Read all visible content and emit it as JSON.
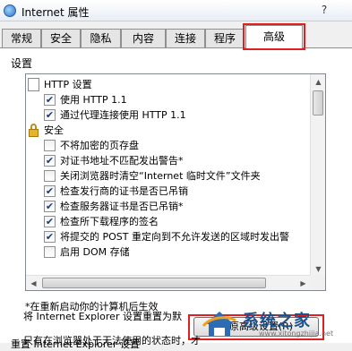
{
  "window": {
    "title": "Internet 属性",
    "help_label": "?"
  },
  "tabs": [
    {
      "label": "常规",
      "active": false
    },
    {
      "label": "安全",
      "active": false
    },
    {
      "label": "隐私",
      "active": false
    },
    {
      "label": "内容",
      "active": false
    },
    {
      "label": "连接",
      "active": false
    },
    {
      "label": "程序",
      "active": false
    },
    {
      "label": "高级",
      "active": true
    }
  ],
  "settings": {
    "group_label": "设置",
    "items": [
      {
        "kind": "category",
        "icon": "document-icon",
        "label": "HTTP 设置"
      },
      {
        "kind": "checkbox",
        "checked": true,
        "label": "使用 HTTP 1.1"
      },
      {
        "kind": "checkbox",
        "checked": true,
        "label": "通过代理连接使用 HTTP 1.1"
      },
      {
        "kind": "category",
        "icon": "lock-icon",
        "label": "安全"
      },
      {
        "kind": "checkbox",
        "checked": false,
        "label": "不将加密的页存盘"
      },
      {
        "kind": "checkbox",
        "checked": true,
        "label": "对证书地址不匹配发出警告*"
      },
      {
        "kind": "checkbox",
        "checked": false,
        "label": "关闭浏览器时清空“Internet 临时文件”文件夹"
      },
      {
        "kind": "checkbox",
        "checked": true,
        "label": "检查发行商的证书是否已吊销"
      },
      {
        "kind": "checkbox",
        "checked": true,
        "label": "检查服务器证书是否已吊销*"
      },
      {
        "kind": "checkbox",
        "checked": true,
        "label": "检查所下载程序的签名"
      },
      {
        "kind": "checkbox",
        "checked": true,
        "label": "将提交的 POST 重定向到不允许发送的区域时发出警"
      },
      {
        "kind": "checkbox",
        "checked": false,
        "label": "启用 DOM 存储"
      }
    ]
  },
  "note": "*在重新启动你的计算机后生效",
  "restore_button": "还原高级设置(R)",
  "reset": {
    "title": "重置 Internet Explorer 设置",
    "description": "将 Internet Explorer 设置重置为默",
    "more": "只有在浏览器处于无法使用的状态时，才"
  },
  "watermark": {
    "text": "系统之家",
    "url": "www.xitongzhijia.net"
  },
  "colors": {
    "highlight": "#e02020",
    "checkmark": "#1b3a7a"
  }
}
